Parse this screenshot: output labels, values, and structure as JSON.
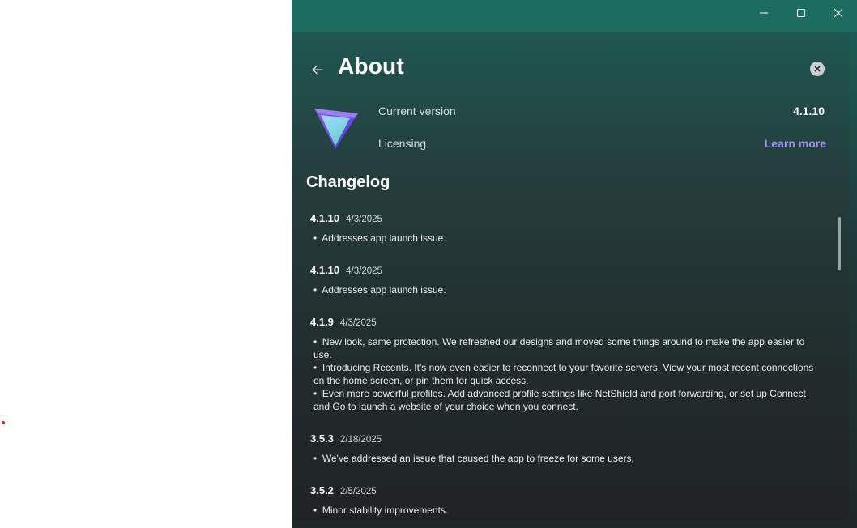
{
  "window_controls": {
    "minimize_icon": "minimize-icon",
    "maximize_icon": "maximize-icon",
    "close_icon": "close-icon"
  },
  "header": {
    "title": "About",
    "back_icon": "arrow-left-icon",
    "close_icon": "close-circle-icon"
  },
  "info": {
    "current_version_label": "Current version",
    "current_version_value": "4.1.10",
    "licensing_label": "Licensing",
    "learn_more_label": "Learn more"
  },
  "changelog": {
    "title": "Changelog",
    "entries": [
      {
        "version": "4.1.10",
        "date": "4/3/2025",
        "notes": [
          "Addresses app launch issue."
        ]
      },
      {
        "version": "4.1.10",
        "date": "4/3/2025",
        "notes": [
          "Addresses app launch issue."
        ]
      },
      {
        "version": "4.1.9",
        "date": "4/3/2025",
        "notes": [
          "New look, same protection. We refreshed our designs and moved some things around to make the app easier to use.",
          "Introducing Recents. It's now even easier to reconnect to your favorite servers. View your most recent connections on the home screen, or pin them for quick access.",
          "Even more powerful profiles. Add advanced profile settings like NetShield and port forwarding, or set up Connect and Go to launch a website of your choice when you connect."
        ]
      },
      {
        "version": "3.5.3",
        "date": "2/18/2025",
        "notes": [
          "We've addressed an issue that caused the app to freeze for some users."
        ]
      },
      {
        "version": "3.5.2",
        "date": "2/5/2025",
        "notes": [
          "Minor stability improvements."
        ]
      }
    ]
  },
  "colors": {
    "accent_link": "#a68cf6",
    "titlebar": "#1c6d60"
  }
}
